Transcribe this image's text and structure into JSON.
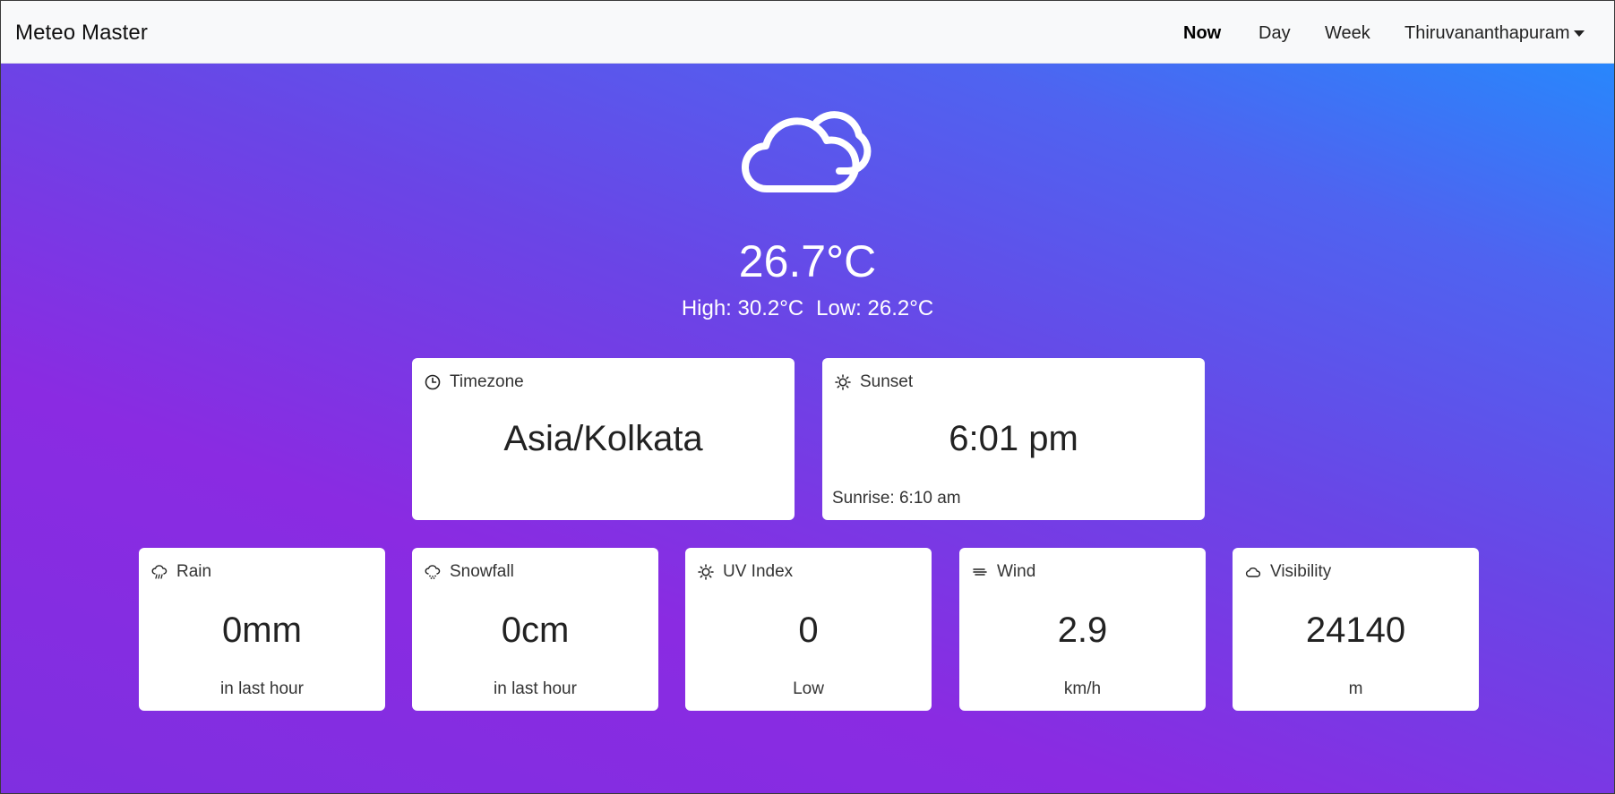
{
  "nav": {
    "brand": "Meteo Master",
    "links": [
      {
        "label": "Now",
        "active": true
      },
      {
        "label": "Day",
        "active": false
      },
      {
        "label": "Week",
        "active": false
      }
    ],
    "location": "Thiruvananthapuram",
    "location_icon": "caret-down-icon"
  },
  "current": {
    "icon": "partly-cloudy-icon",
    "temperature": "26.7°C",
    "high": "High: 30.2°C",
    "low": "Low: 26.2°C"
  },
  "cards": {
    "timezone": {
      "icon": "clock-icon",
      "label": "Timezone",
      "value": "Asia/Kolkata"
    },
    "sunset": {
      "icon": "sunset-icon",
      "label": "Sunset",
      "value": "6:01 pm",
      "sub": "Sunrise: 6:10 am"
    },
    "rain": {
      "icon": "rain-icon",
      "label": "Rain",
      "value": "0mm",
      "sub": "in last hour"
    },
    "snowfall": {
      "icon": "snow-icon",
      "label": "Snowfall",
      "value": "0cm",
      "sub": "in last hour"
    },
    "uv": {
      "icon": "sun-icon",
      "label": "UV Index",
      "value": "0",
      "sub": "Low"
    },
    "wind": {
      "icon": "wind-icon",
      "label": "Wind",
      "value": "2.9",
      "sub": "km/h"
    },
    "visibility": {
      "icon": "cloud-icon",
      "label": "Visibility",
      "value": "24140",
      "sub": "m"
    }
  },
  "colors": {
    "gradient_top_right": "#1e90ff",
    "gradient_mid": "#6a45e6",
    "gradient_bottom_left": "#8a2be2",
    "navbar_bg": "#f8f9fa",
    "card_bg": "#ffffff"
  }
}
